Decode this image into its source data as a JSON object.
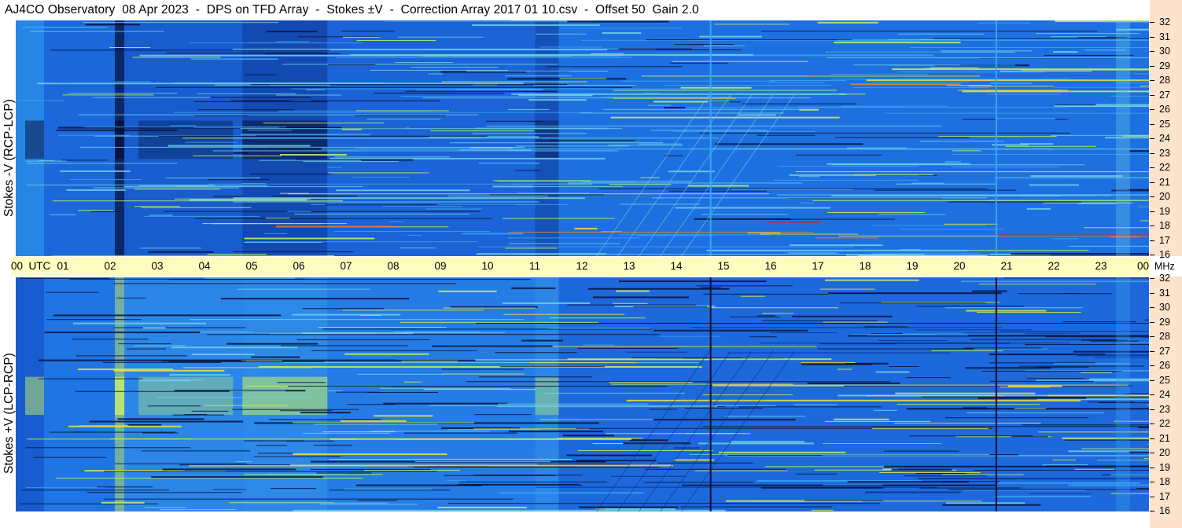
{
  "title": "AJ4CO Observatory  08 Apr 2023  -  DPS on TFD Array  -  Stokes ±V  -  Correction Array 2017 01 10.csv  -  Offset 50  Gain 2.0",
  "chart_data": [
    {
      "type": "heatmap",
      "title": "",
      "ylabel": "Stokes -V (RCP-LCP)",
      "xlabel": "",
      "x_ticks": [
        "00",
        "01",
        "02",
        "03",
        "04",
        "05",
        "06",
        "07",
        "08",
        "09",
        "10",
        "11",
        "12",
        "13",
        "14",
        "15",
        "16",
        "17",
        "18",
        "19",
        "20",
        "21",
        "22",
        "23",
        "00"
      ],
      "x_range_utc_hours": [
        0,
        24
      ],
      "y_ticks": [
        "16",
        "17",
        "18",
        "19",
        "20",
        "21",
        "22",
        "23",
        "24",
        "25",
        "26",
        "27",
        "28",
        "29",
        "30",
        "31",
        "32"
      ],
      "y_range_mhz": [
        16,
        32
      ],
      "colormap": [
        "#07103a",
        "#0a2e8c",
        "#1351c4",
        "#1f7be6",
        "#3aa4f0",
        "#6fd0e8",
        "#c9f060",
        "#f0e040",
        "#f08020",
        "#e02020"
      ],
      "interference_lines_utc_hours": [
        14.7,
        20.75
      ]
    },
    {
      "type": "heatmap",
      "title": "",
      "ylabel": "Stokes +V (LCP-RCP)",
      "xlabel": "",
      "x_ticks": [
        "00",
        "01",
        "02",
        "03",
        "04",
        "05",
        "06",
        "07",
        "08",
        "09",
        "10",
        "11",
        "12",
        "13",
        "14",
        "15",
        "16",
        "17",
        "18",
        "19",
        "20",
        "21",
        "22",
        "23",
        "00"
      ],
      "x_range_utc_hours": [
        0,
        24
      ],
      "y_ticks": [
        "16",
        "17",
        "18",
        "19",
        "20",
        "21",
        "22",
        "23",
        "24",
        "25",
        "26",
        "27",
        "28",
        "29",
        "30",
        "31",
        "32"
      ],
      "y_range_mhz": [
        16,
        32
      ],
      "colormap": [
        "#07103a",
        "#0a2e8c",
        "#1351c4",
        "#1f7be6",
        "#3aa4f0",
        "#6fd0e8",
        "#c9f060",
        "#f0e040",
        "#f08020",
        "#e02020"
      ],
      "interference_lines_utc_hours": [
        14.7,
        20.75
      ]
    }
  ],
  "time_axis": {
    "utc_label": "UTC",
    "mhz_label": "MHz"
  },
  "colors": {
    "time_axis_bg": "#fffcc0",
    "freq_axis_bg": "#fde3cc",
    "base_blue": "#1f6ee0"
  }
}
